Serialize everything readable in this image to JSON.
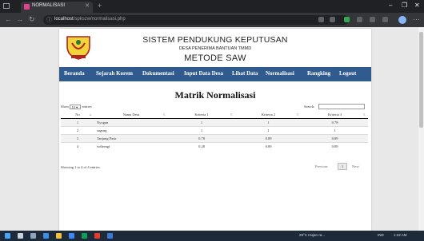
{
  "browser": {
    "tab_title": "NORMALISASI",
    "url_host": "localhost",
    "url_path": "/spkszw/normalisasi.php"
  },
  "header": {
    "title": "SISTEM PENDUKUNG KEPUTUSAN",
    "subtitle": "DESA PENERIMA BANTUAN TMMD",
    "method": "METODE SAW"
  },
  "nav": {
    "items": [
      "Beranda",
      "Sejarah Korem",
      "Dokumentasi",
      "Input Data Desa",
      "Lihat Data",
      "Normalisasi",
      "Rangking",
      "Logout"
    ]
  },
  "main": {
    "title": "Matrik Normalisasi",
    "show_prefix": "Show",
    "show_value": "10",
    "show_suffix": "entries",
    "search_label": "Search:",
    "columns": [
      "No",
      "Nama Desa",
      "Kriteria 1",
      "Kriteria 2",
      "Kriteria 3"
    ],
    "rows": [
      {
        "no": "1",
        "nama": "Nyogan",
        "k1": "1",
        "k2": "1",
        "k3": "0.78"
      },
      {
        "no": "2",
        "nama": "sngsng",
        "k1": "1",
        "k2": "1",
        "k3": "1"
      },
      {
        "no": "3",
        "nama": "Tanjung Pasir",
        "k1": "0.78",
        "k2": "0.89",
        "k3": "0.89"
      },
      {
        "no": "4",
        "nama": "wdfrengf",
        "k1": "0.28",
        "k2": "0.89",
        "k3": "0.89"
      }
    ],
    "info": "Showing 1 to 4 of 4 entries",
    "previous": "Previous",
    "page": "1",
    "next": "Next"
  },
  "taskbar": {
    "weather": "29°C Hujan ra...",
    "lang": "IND",
    "time": "1:22 AM"
  },
  "colors": {
    "nav_bg": "#2f5b8e",
    "chrome_dark": "#202124"
  }
}
